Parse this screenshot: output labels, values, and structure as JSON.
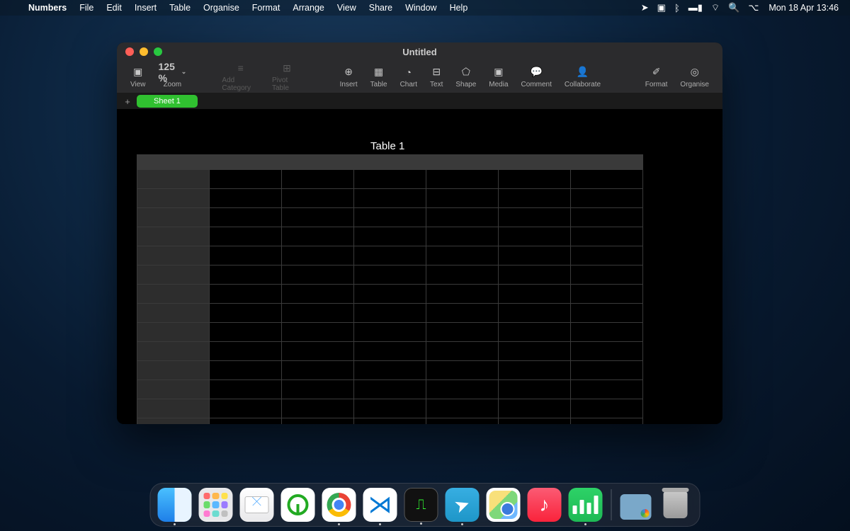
{
  "menubar": {
    "app_name": "Numbers",
    "items": [
      "File",
      "Edit",
      "Insert",
      "Table",
      "Organise",
      "Format",
      "Arrange",
      "View",
      "Share",
      "Window",
      "Help"
    ],
    "clock": "Mon 18 Apr  13:46"
  },
  "window": {
    "title": "Untitled",
    "toolbar": {
      "view": "View",
      "zoom_label": "Zoom",
      "zoom_value": "125 %",
      "add_category": "Add Category",
      "pivot_table": "Pivot Table",
      "insert": "Insert",
      "table": "Table",
      "chart": "Chart",
      "text": "Text",
      "shape": "Shape",
      "media": "Media",
      "comment": "Comment",
      "collaborate": "Collaborate",
      "format": "Format",
      "organise": "Organise"
    },
    "sheet_tab": "Sheet 1",
    "table_title": "Table 1",
    "grid": {
      "rows": 20,
      "cols": 7
    }
  },
  "dock": {
    "items": [
      {
        "name": "finder",
        "running": true
      },
      {
        "name": "launchpad",
        "running": false
      },
      {
        "name": "mail",
        "running": false
      },
      {
        "name": "keepass",
        "running": false
      },
      {
        "name": "chrome",
        "running": true
      },
      {
        "name": "vscode",
        "running": true
      },
      {
        "name": "activity-monitor",
        "running": true
      },
      {
        "name": "telegram",
        "running": true
      },
      {
        "name": "maps",
        "running": false
      },
      {
        "name": "music",
        "running": false
      },
      {
        "name": "numbers",
        "running": true
      }
    ]
  }
}
